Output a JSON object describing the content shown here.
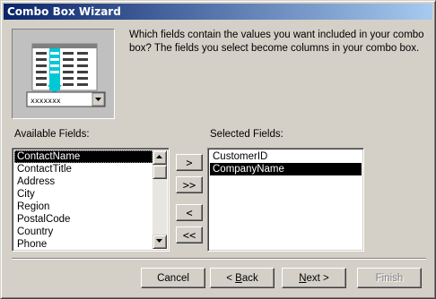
{
  "window": {
    "title": "Combo Box Wizard"
  },
  "instructions": "Which fields contain the values you want included in your combo box? The fields you select become columns in your combo box.",
  "illustration": {
    "combo_text": "xxxxxxx",
    "arrow_color": "#00c8d4"
  },
  "available": {
    "label": "Available Fields:",
    "items": [
      "ContactName",
      "ContactTitle",
      "Address",
      "City",
      "Region",
      "PostalCode",
      "Country",
      "Phone"
    ],
    "selected_index": 0
  },
  "selected": {
    "label": "Selected Fields:",
    "items": [
      "CustomerID",
      "CompanyName"
    ],
    "selected_index": 1
  },
  "move_buttons": {
    "add_one": ">",
    "add_all": ">>",
    "remove_one": "<",
    "remove_all": "<<"
  },
  "footer": {
    "cancel": "Cancel",
    "back_prefix": "< ",
    "back_accel": "B",
    "back_rest": "ack",
    "next_prefix": "",
    "next_accel": "N",
    "next_rest": "ext >",
    "finish": "Finish"
  },
  "colors": {
    "title_start": "#0a246a",
    "title_end": "#a6caf0",
    "face": "#d4d0c8",
    "selection": "#000000"
  }
}
